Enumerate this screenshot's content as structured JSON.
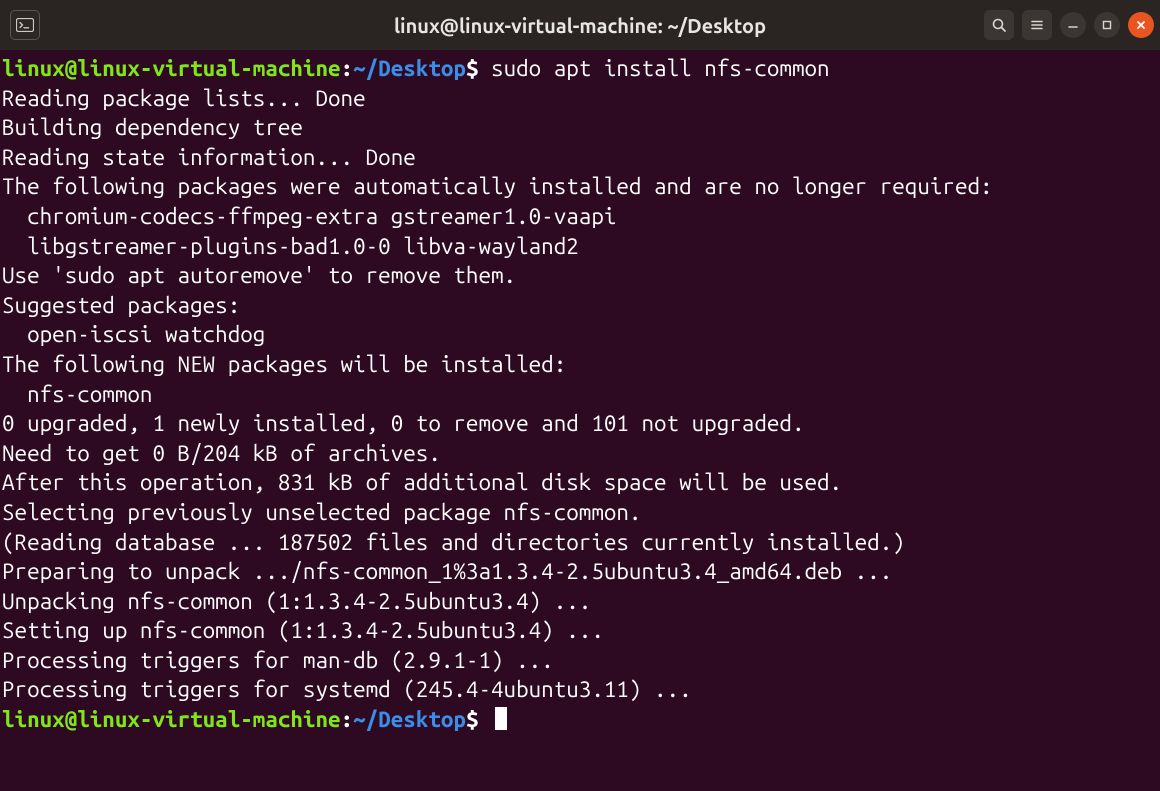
{
  "window": {
    "title": "linux@linux-virtual-machine: ~/Desktop"
  },
  "prompt": {
    "user_host": "linux@linux-virtual-machine",
    "colon": ":",
    "path_tilde": "~",
    "path_rest": "/Desktop",
    "dollar": "$"
  },
  "command1": " sudo apt install nfs-common",
  "output_lines": [
    "Reading package lists... Done",
    "Building dependency tree",
    "Reading state information... Done",
    "The following packages were automatically installed and are no longer required:",
    "  chromium-codecs-ffmpeg-extra gstreamer1.0-vaapi",
    "  libgstreamer-plugins-bad1.0-0 libva-wayland2",
    "Use 'sudo apt autoremove' to remove them.",
    "Suggested packages:",
    "  open-iscsi watchdog",
    "The following NEW packages will be installed:",
    "  nfs-common",
    "0 upgraded, 1 newly installed, 0 to remove and 101 not upgraded.",
    "Need to get 0 B/204 kB of archives.",
    "After this operation, 831 kB of additional disk space will be used.",
    "Selecting previously unselected package nfs-common.",
    "(Reading database ... 187502 files and directories currently installed.)",
    "Preparing to unpack .../nfs-common_1%3a1.3.4-2.5ubuntu3.4_amd64.deb ...",
    "Unpacking nfs-common (1:1.3.4-2.5ubuntu3.4) ...",
    "Setting up nfs-common (1:1.3.4-2.5ubuntu3.4) ...",
    "Processing triggers for man-db (2.9.1-1) ...",
    "Processing triggers for systemd (245.4-4ubuntu3.11) ..."
  ],
  "command2": " "
}
